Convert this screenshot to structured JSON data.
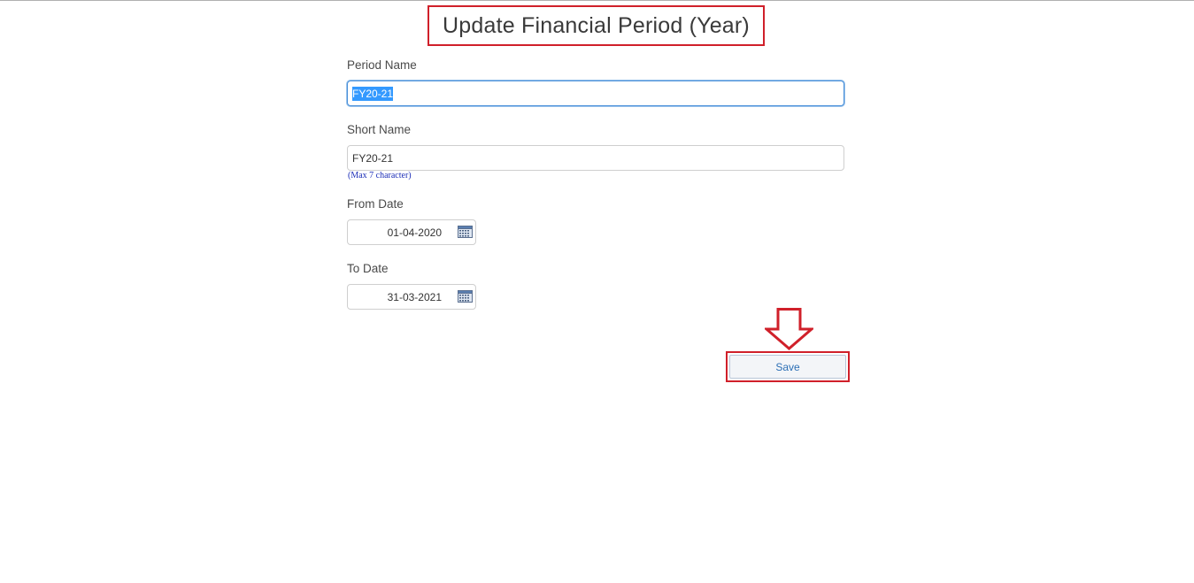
{
  "form": {
    "title": "Update Financial Period (Year)",
    "period_name": {
      "label": "Period Name",
      "value": "FY20-21"
    },
    "short_name": {
      "label": "Short Name",
      "value": "FY20-21",
      "hint": "(Max 7 character)"
    },
    "from_date": {
      "label": "From Date",
      "value": "01-04-2020",
      "icon": "calendar-icon"
    },
    "to_date": {
      "label": "To Date",
      "value": "31-03-2021",
      "icon": "calendar-icon"
    },
    "save_label": "Save"
  },
  "annotations": {
    "highlight_color": "#d0202a",
    "arrow_icon": "down-arrow-icon"
  },
  "colors": {
    "focus_border": "#4a90d9",
    "selection": "#3399ff",
    "hint_text": "#1d2fb8",
    "button_text": "#2c6fb5"
  }
}
